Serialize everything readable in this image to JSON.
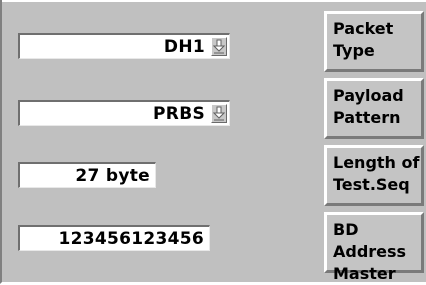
{
  "fields": [
    {
      "name": "packet-type",
      "value": "DH1",
      "dropdown": true
    },
    {
      "name": "payload-pattern",
      "value": "PRBS",
      "dropdown": true
    },
    {
      "name": "length-of-test-seq",
      "value": "27 byte",
      "dropdown": false
    },
    {
      "name": "bd-address-master",
      "value": "123456123456",
      "dropdown": false
    }
  ],
  "softkeys": [
    {
      "label": "Packet\nType"
    },
    {
      "label": "Payload\nPattern"
    },
    {
      "label": "Length of\nTest.Seq"
    },
    {
      "label": "BD Address\nMaster"
    }
  ],
  "icons": {
    "dropdown": "down-arrow-icon"
  },
  "colors": {
    "panel": "#c0c0c0",
    "field": "#ffffff",
    "text": "#000000"
  }
}
